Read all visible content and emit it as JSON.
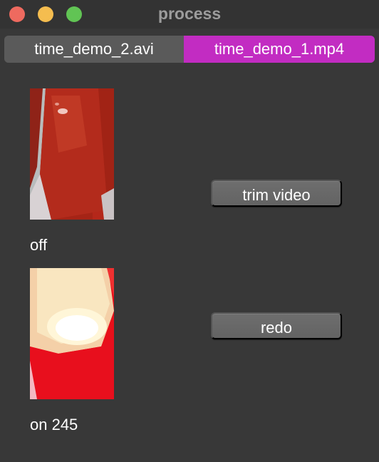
{
  "window": {
    "title": "process",
    "controls": [
      "close",
      "minimize",
      "zoom"
    ]
  },
  "tabs": [
    {
      "label": "time_demo_2.avi",
      "selected": false
    },
    {
      "label": "time_demo_1.mp4",
      "selected": true
    }
  ],
  "accent_color": "#c22cc2",
  "items": [
    {
      "image": "video-frame-red-off",
      "caption": "off"
    },
    {
      "image": "video-frame-red-on",
      "caption": "on 245"
    }
  ],
  "buttons": {
    "trim": "trim video",
    "redo": "redo"
  }
}
